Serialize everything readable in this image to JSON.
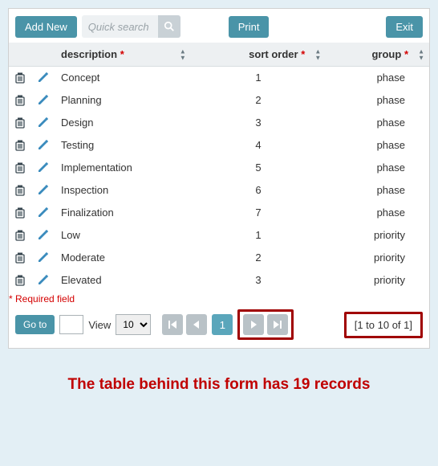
{
  "toolbar": {
    "add_label": "Add New",
    "search_placeholder": "Quick search",
    "print_label": "Print",
    "exit_label": "Exit"
  },
  "columns": {
    "description": "description",
    "sort_order": "sort order",
    "group": "group"
  },
  "rows": [
    {
      "description": "Concept",
      "sort_order": "1",
      "group": "phase"
    },
    {
      "description": "Planning",
      "sort_order": "2",
      "group": "phase"
    },
    {
      "description": "Design",
      "sort_order": "3",
      "group": "phase"
    },
    {
      "description": "Testing",
      "sort_order": "4",
      "group": "phase"
    },
    {
      "description": "Implementation",
      "sort_order": "5",
      "group": "phase"
    },
    {
      "description": "Inspection",
      "sort_order": "6",
      "group": "phase"
    },
    {
      "description": "Finalization",
      "sort_order": "7",
      "group": "phase"
    },
    {
      "description": "Low",
      "sort_order": "1",
      "group": "priority"
    },
    {
      "description": "Moderate",
      "sort_order": "2",
      "group": "priority"
    },
    {
      "description": "Elevated",
      "sort_order": "3",
      "group": "priority"
    }
  ],
  "required_note": "* Required field",
  "footer": {
    "go_label": "Go to",
    "view_label": "View",
    "page_size": "10",
    "current_page": "1",
    "range_text": "[1 to 10 of 1]"
  },
  "caption": "The table behind this form has 19 records"
}
